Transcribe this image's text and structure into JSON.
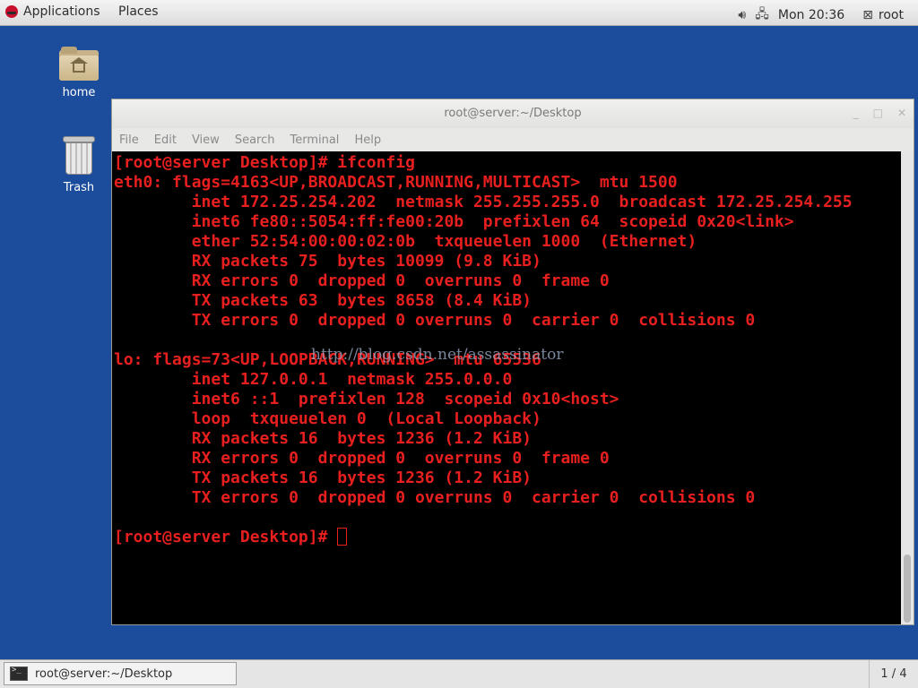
{
  "top_panel": {
    "applications": "Applications",
    "places": "Places",
    "clock": "Mon 20:36",
    "user": "root"
  },
  "desktop": {
    "home_label": "home",
    "trash_label": "Trash"
  },
  "window": {
    "title": "root@server:~/Desktop",
    "menu": [
      "File",
      "Edit",
      "View",
      "Search",
      "Terminal",
      "Help"
    ]
  },
  "terminal": {
    "lines": [
      "[root@server Desktop]# ifconfig",
      "eth0: flags=4163<UP,BROADCAST,RUNNING,MULTICAST>  mtu 1500",
      "        inet 172.25.254.202  netmask 255.255.255.0  broadcast 172.25.254.255",
      "        inet6 fe80::5054:ff:fe00:20b  prefixlen 64  scopeid 0x20<link>",
      "        ether 52:54:00:00:02:0b  txqueuelen 1000  (Ethernet)",
      "        RX packets 75  bytes 10099 (9.8 KiB)",
      "        RX errors 0  dropped 0  overruns 0  frame 0",
      "        TX packets 63  bytes 8658 (8.4 KiB)",
      "        TX errors 0  dropped 0 overruns 0  carrier 0  collisions 0",
      "",
      "lo: flags=73<UP,LOOPBACK,RUNNING>  mtu 65536",
      "        inet 127.0.0.1  netmask 255.0.0.0",
      "        inet6 ::1  prefixlen 128  scopeid 0x10<host>",
      "        loop  txqueuelen 0  (Local Loopback)",
      "        RX packets 16  bytes 1236 (1.2 KiB)",
      "        RX errors 0  dropped 0  overruns 0  frame 0",
      "        TX packets 16  bytes 1236 (1.2 KiB)",
      "        TX errors 0  dropped 0 overruns 0  carrier 0  collisions 0",
      ""
    ],
    "prompt": "[root@server Desktop]# ",
    "watermark": "http://blog.csdn.net/assassinator",
    "text_color": "#e81f1f"
  },
  "taskbar": {
    "item_label": "root@server:~/Desktop",
    "workspace": "1 / 4"
  }
}
